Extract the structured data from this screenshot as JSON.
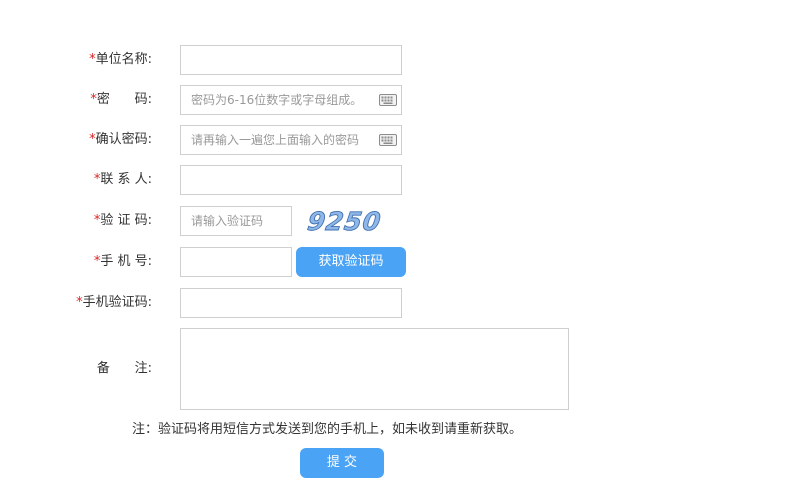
{
  "form": {
    "fields": {
      "org_name": {
        "label": "单位名称:",
        "value": ""
      },
      "password": {
        "label": "密      码:",
        "placeholder": "密码为6-16位数字或字母组成。"
      },
      "confirm_password": {
        "label": "确认密码:",
        "placeholder": "请再输入一遍您上面输入的密码"
      },
      "contact": {
        "label": "联 系 人:",
        "value": ""
      },
      "captcha": {
        "label": "验 证 码:",
        "placeholder": "请输入验证码",
        "image_text": "9250"
      },
      "phone": {
        "label": "手 机 号:",
        "value": "",
        "get_code_button": "获取验证码"
      },
      "phone_code": {
        "label": "手机验证码:",
        "value": ""
      },
      "remarks": {
        "label": "备      注:",
        "value": ""
      }
    },
    "required_marker": "*",
    "note": "注：验证码将用短信方式发送到您的手机上，如未收到请重新获取。",
    "submit_label": "提 交"
  },
  "colors": {
    "accent": "#4aa3f5",
    "required": "#e02020",
    "border": "#cfcfcf"
  },
  "icons": {
    "keyboard": "keyboard-icon"
  }
}
